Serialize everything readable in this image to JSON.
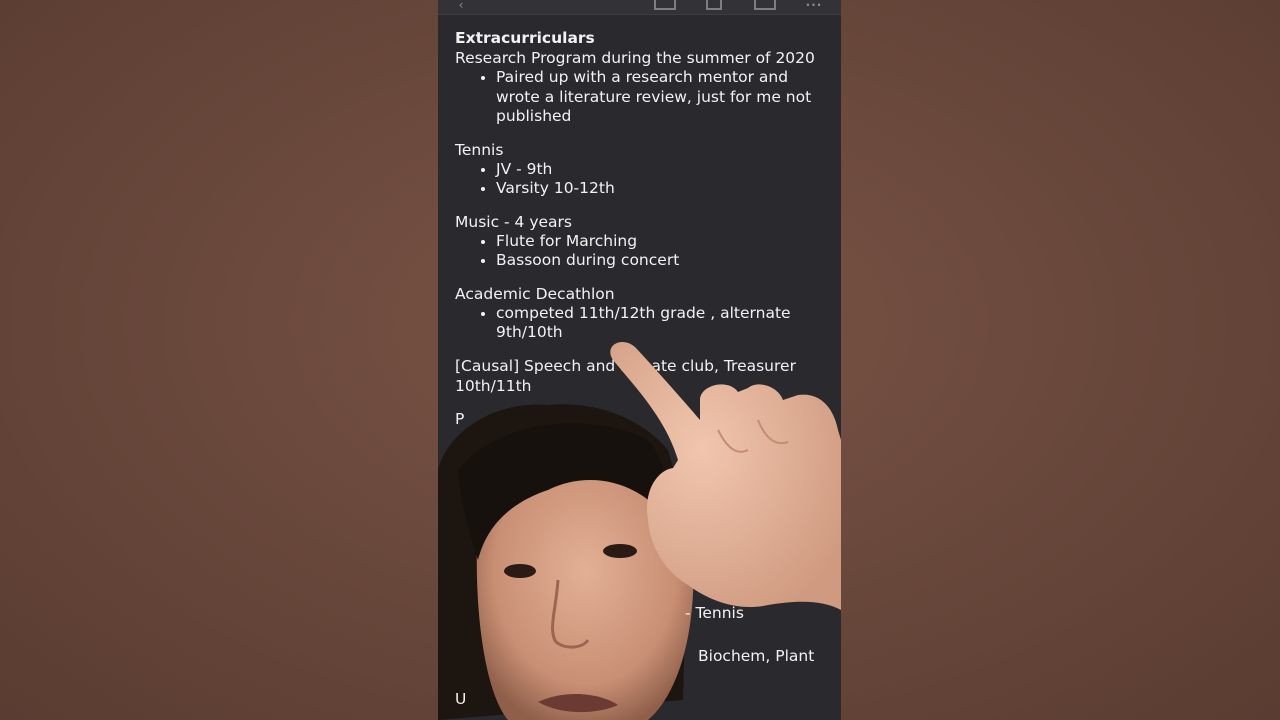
{
  "toolbar": {
    "icons": [
      "back-icon",
      "download-icon",
      "trash-icon",
      "mail-icon",
      "more-icon"
    ]
  },
  "doc": {
    "heading": "Extracurriculars",
    "sections": [
      {
        "title": "Research Program during the summer of 2020",
        "bullets": [
          "Paired up with a research mentor and wrote a literature review, just for me not published"
        ]
      },
      {
        "title": "Tennis",
        "bullets": [
          "JV - 9th",
          "Varsity 10-12th"
        ]
      },
      {
        "title": "Music - 4 years",
        "bullets": [
          "Flute for Marching",
          "Bassoon during concert"
        ]
      },
      {
        "title": "Academic Decathlon",
        "bullets": [
          "competed 11th/12th grade , alternate 9th/10th"
        ]
      },
      {
        "title": "[Causal] Speech and Debate club, Treasurer 10th/11th",
        "bullets": []
      }
    ],
    "partial_text": {
      "p_fragment": "P",
      "tennis_fragment": "- Tennis",
      "biochem_fragment": "Biochem, Plant",
      "u_fragment": "U"
    }
  }
}
